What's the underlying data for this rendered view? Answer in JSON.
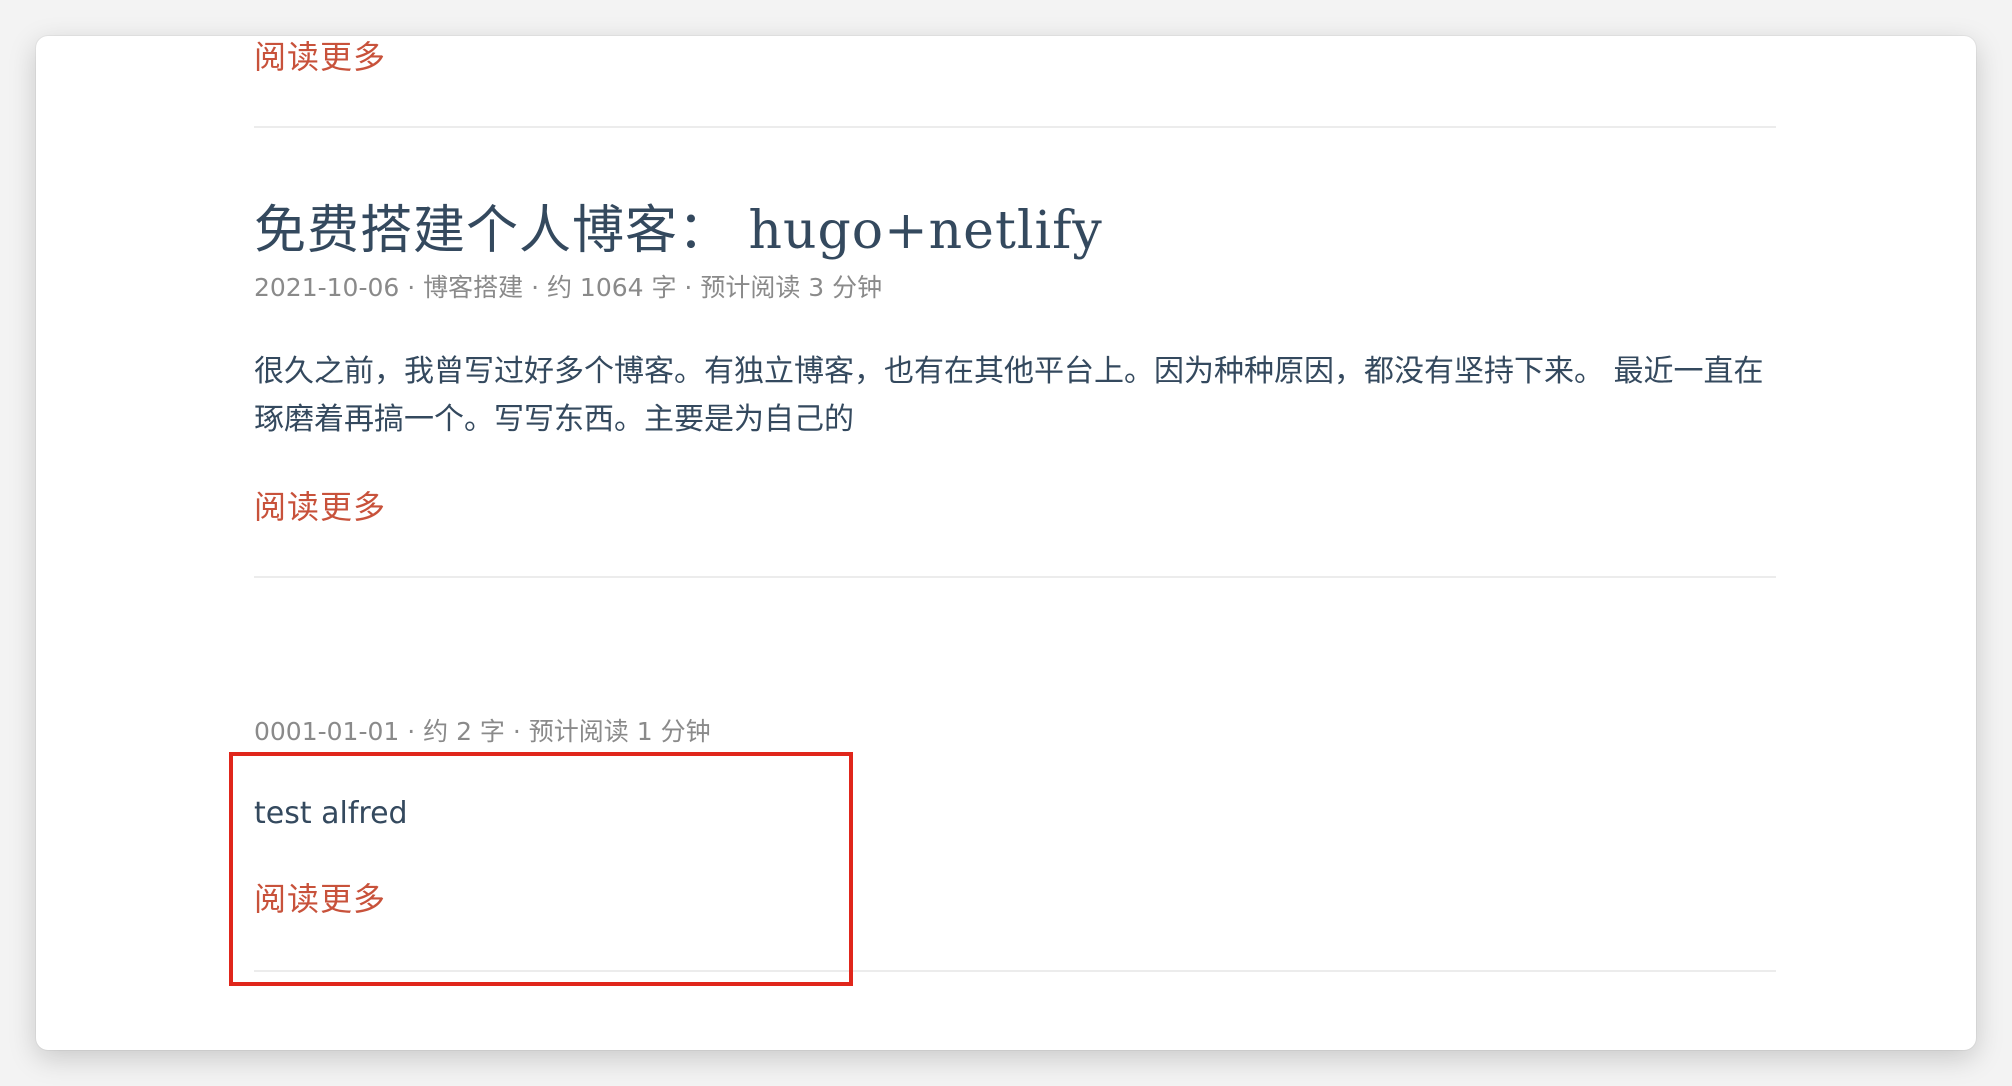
{
  "posts": [
    {
      "read_more": "阅读更多"
    },
    {
      "title": "免费搭建个人博客：  hugo+netlify",
      "meta": "2021-10-06 · 博客搭建 · 约 1064 字 · 预计阅读 3 分钟",
      "summary": "很久之前，我曾写过好多个博客。有独立博客，也有在其他平台上。因为种种原因，都没有坚持下来。 最近一直在琢磨着再搞一个。写写东西。主要是为自己的",
      "read_more": "阅读更多"
    },
    {
      "meta": "0001-01-01 · 约 2 字 · 预计阅读 1 分钟",
      "summary": "test alfred",
      "read_more": "阅读更多"
    }
  ],
  "colors": {
    "link": "#c8523b",
    "title": "#34495e",
    "meta": "#8a8a8a",
    "highlight": "#e0261b"
  }
}
